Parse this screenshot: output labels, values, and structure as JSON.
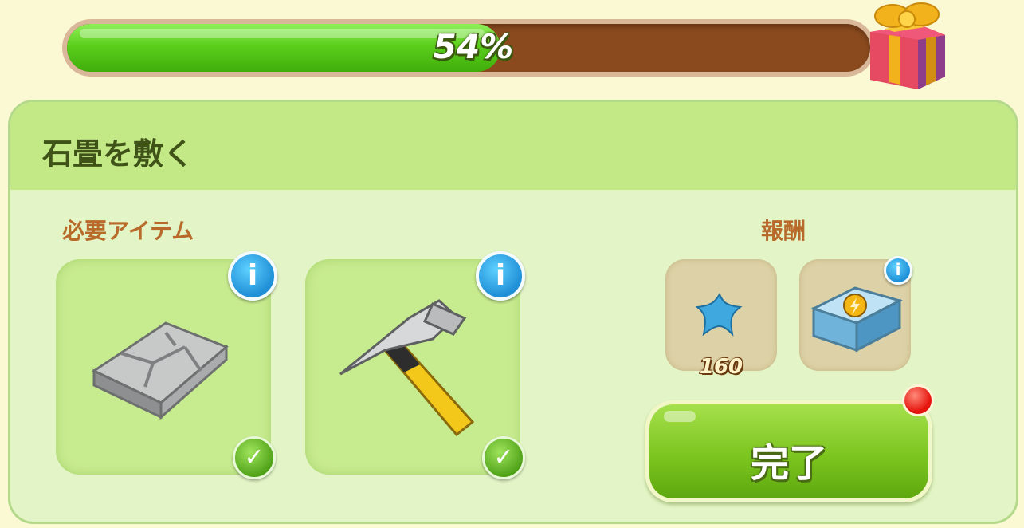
{
  "progress": {
    "percent_label": "54%",
    "value": 0.54,
    "reward_icon": "gift-box-icon"
  },
  "task": {
    "title": "石畳を敷く"
  },
  "required": {
    "heading": "必要アイテム",
    "items": [
      {
        "name": "cobblestone-icon",
        "info": "i",
        "checked": true
      },
      {
        "name": "hammer-icon",
        "info": "i",
        "checked": true
      }
    ]
  },
  "rewards": {
    "heading": "報酬",
    "items": [
      {
        "icon": "blue-star-icon",
        "count": "160"
      },
      {
        "icon": "energy-chest-icon",
        "info": "i"
      }
    ]
  },
  "complete_button": {
    "label": "完了"
  },
  "colors": {
    "progress_fill": "#5ccf1c",
    "progress_track": "#8a4a1e",
    "header": "#c2e986",
    "panel": "#e3f5c6",
    "label_orange": "#b86a2a"
  }
}
